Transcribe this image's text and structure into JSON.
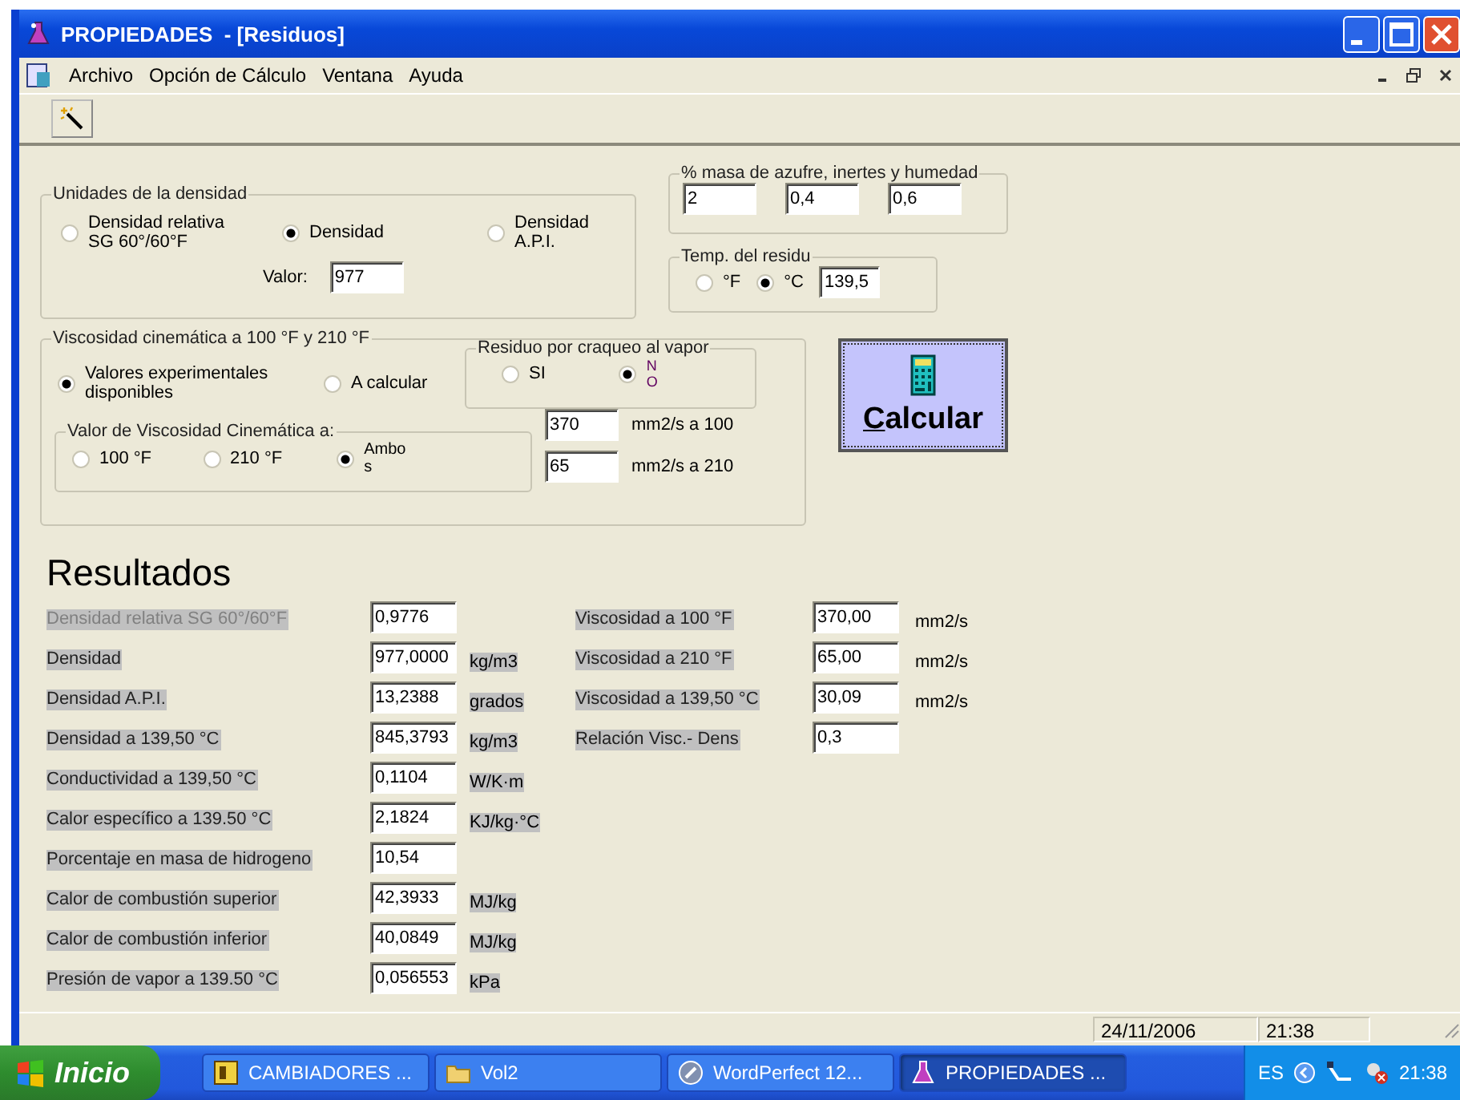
{
  "window": {
    "title": "PROPIEDADES  - [Residuos]"
  },
  "menu": [
    {
      "label": "Archivo"
    },
    {
      "label": "Opción de Cálculo"
    },
    {
      "label": "Ventana"
    },
    {
      "label": "Ayuda"
    }
  ],
  "density_units": {
    "title": "Unidades de la densidad",
    "options": [
      {
        "label": "Densidad relativa SG 60°/60°F",
        "selected": false
      },
      {
        "label": "Densidad",
        "selected": true
      },
      {
        "label": "Densidad A.P.I.",
        "selected": false
      }
    ],
    "value_label": "Valor:",
    "value": "977"
  },
  "mass_percent": {
    "title": "% masa de azufre, inertes y humedad",
    "values": [
      "2",
      "0,4",
      "0,6"
    ]
  },
  "temperature": {
    "title": "Temp. del residu",
    "options": [
      {
        "label": "°F",
        "selected": false
      },
      {
        "label": "°C",
        "selected": true
      }
    ],
    "value": "139,5"
  },
  "viscosity": {
    "title": "Viscosidad cinemática a 100 °F y 210 °F",
    "options": [
      {
        "label": "Valores experimentales disponibles",
        "selected": true
      },
      {
        "label": "A calcular",
        "selected": false
      }
    ],
    "cracking": {
      "title": "Residuo por craqueo al vapor",
      "options": [
        {
          "label": "SI",
          "selected": false
        },
        {
          "label": "NO",
          "selected": true
        }
      ]
    },
    "temperature_choice": {
      "title": "Valor de Viscosidad Cinemática a:",
      "options": [
        {
          "label": "100 °F",
          "selected": false
        },
        {
          "label": "210 °F",
          "selected": false
        },
        {
          "label": "Ambos",
          "selected": true
        }
      ]
    },
    "inputs": [
      {
        "value": "370",
        "unit": "mm2/s a 100"
      },
      {
        "value": "65",
        "unit": "mm2/s a 210"
      }
    ]
  },
  "calculate_button": {
    "label": "Calcular"
  },
  "results": {
    "title": "Resultados",
    "left": [
      {
        "label": "Densidad relativa SG 60°/60°F",
        "value": "0,9776",
        "disabled": true
      },
      {
        "label": "Densidad",
        "value": "977,0000",
        "unit": "kg/m3",
        "disabled": false
      },
      {
        "label": "Densidad A.P.I.",
        "value": "13,2388",
        "unit": "grados",
        "disabled": false
      },
      {
        "label": "Densidad a 139,50 °C",
        "value": "845,3793",
        "unit": "kg/m3",
        "disabled": false
      },
      {
        "label": "Conductividad a 139,50 °C",
        "value": "0,1104",
        "unit": "W/K·m",
        "disabled": false
      },
      {
        "label": "Calor específico a 139.50 °C",
        "value": "2,1824",
        "unit": "KJ/kg·°C",
        "disabled": false
      },
      {
        "label": "Porcentaje en masa de hidrogeno",
        "value": "10,54",
        "disabled": false
      },
      {
        "label": "Calor de combustión superior",
        "value": "42,3933",
        "unit": "MJ/kg",
        "disabled": false
      },
      {
        "label": "Calor de combustión inferior",
        "value": "40,0849",
        "unit": "MJ/kg",
        "disabled": false
      },
      {
        "label": "Presión de vapor a 139.50 °C",
        "value": "0,056553",
        "unit": "kPa",
        "disabled": false
      }
    ],
    "right": [
      {
        "label": "Viscosidad a 100 °F",
        "value": "370,00",
        "unit": "mm2/s",
        "disabled": false
      },
      {
        "label": "Viscosidad a 210 °F",
        "value": "65,00",
        "unit": "mm2/s",
        "disabled": false
      },
      {
        "label": "Viscosidad a 139,50 °C",
        "value": "30,09",
        "unit": "mm2/s",
        "disabled": false
      },
      {
        "label": "Relación Visc.- Dens",
        "value": "0,3",
        "disabled": false
      }
    ]
  },
  "status_bar": [
    "24/11/2006",
    "21:38"
  ],
  "taskbar": {
    "start": "Inicio",
    "tasks": [
      {
        "label": "CAMBIADORES ...",
        "selected": false
      },
      {
        "label": "Vol2",
        "selected": false
      },
      {
        "label": "WordPerfect 12...",
        "selected": false
      },
      {
        "label": "PROPIEDADES ...",
        "selected": true
      }
    ],
    "language": "ES",
    "clock": "21:38"
  }
}
